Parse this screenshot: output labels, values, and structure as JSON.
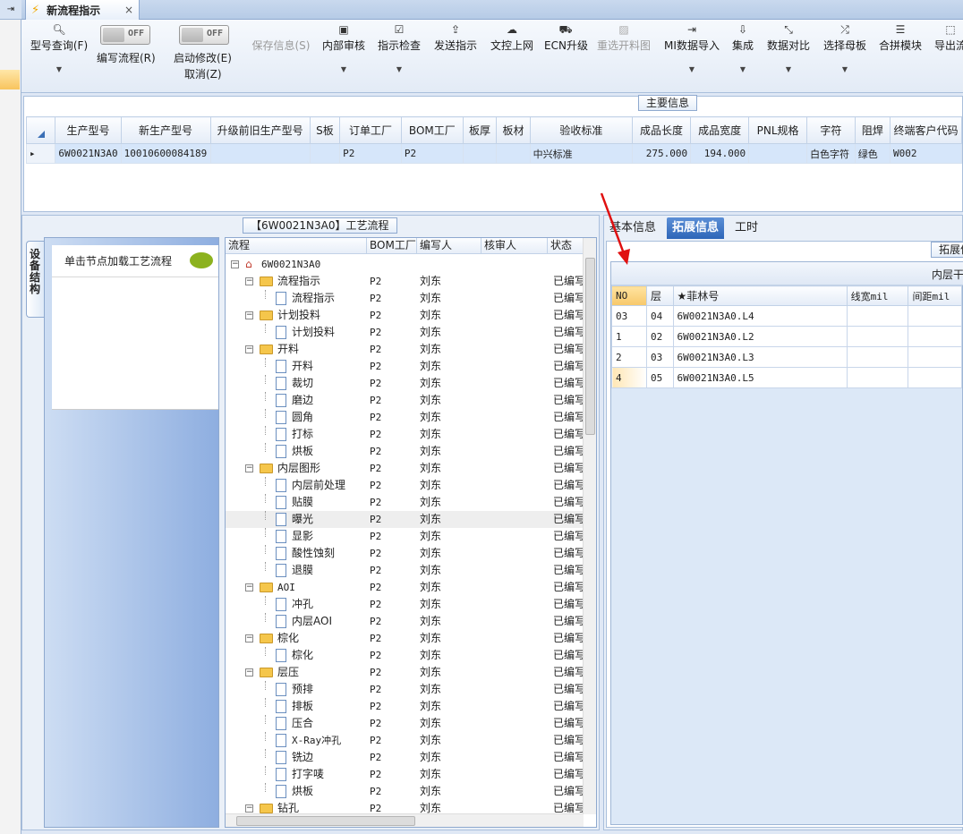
{
  "tab": {
    "title": "新流程指示",
    "close": "×"
  },
  "toolbar": {
    "model_query": "型号查询(F)",
    "write_flow": "编写流程(R)",
    "write_flow_toggle": "OFF",
    "start_modify": "启动修改(E)",
    "start_modify_toggle": "OFF",
    "cancel": "取消(Z)",
    "save_info": "保存信息(S)",
    "internal_review": "内部审核",
    "instruction_check": "指示检查",
    "send_instruction": "发送指示",
    "upload_doc": "文控上网",
    "ecn_upgrade": "ECN升级",
    "reselect_cut": "重选开料图",
    "mi_import": "MI数据导入",
    "integrate": "集成",
    "data_compare": "数据对比",
    "select_mother": "选择母板",
    "combine_module": "合拼模块",
    "export": "导出流"
  },
  "main_info": {
    "title": "主要信息",
    "columns": [
      "生产型号",
      "新生产型号",
      "升级前旧生产型号",
      "S板",
      "订单工厂",
      "BOM工厂",
      "板厚",
      "板材",
      "验收标准",
      "成品长度",
      "成品宽度",
      "PNL规格",
      "字符",
      "阻焊",
      "终端客户代码"
    ],
    "row": [
      "6W0021N3A0",
      "10010600084189",
      "",
      "",
      "P2",
      "P2",
      "",
      "",
      "中兴标准",
      "275.000",
      "194.000",
      "",
      "白色字符",
      "绿色",
      "W002"
    ]
  },
  "flow_panel": {
    "title": "【6W0021N3A0】工艺流程",
    "vertical_tab": "设备结构",
    "struct_hint": "单击节点加载工艺流程",
    "headers": [
      "流程",
      "BOM工厂",
      "编写人",
      "核审人",
      "状态"
    ],
    "rows": [
      {
        "name": "6W0021N3A0",
        "bom": "",
        "writer": "",
        "reviewer": "",
        "status": ""
      },
      {
        "name": "流程指示",
        "bom": "P2",
        "writer": "刘东",
        "reviewer": "",
        "status": "已编写"
      },
      {
        "name": "流程指示",
        "bom": "P2",
        "writer": "刘东",
        "reviewer": "",
        "status": "已编写"
      },
      {
        "name": "计划投料",
        "bom": "P2",
        "writer": "刘东",
        "reviewer": "",
        "status": "已编写"
      },
      {
        "name": "计划投料",
        "bom": "P2",
        "writer": "刘东",
        "reviewer": "",
        "status": "已编写"
      },
      {
        "name": "开料",
        "bom": "P2",
        "writer": "刘东",
        "reviewer": "",
        "status": "已编写"
      },
      {
        "name": "开料",
        "bom": "P2",
        "writer": "刘东",
        "reviewer": "",
        "status": "已编写"
      },
      {
        "name": "裁切",
        "bom": "P2",
        "writer": "刘东",
        "reviewer": "",
        "status": "已编写"
      },
      {
        "name": "磨边",
        "bom": "P2",
        "writer": "刘东",
        "reviewer": "",
        "status": "已编写"
      },
      {
        "name": "圆角",
        "bom": "P2",
        "writer": "刘东",
        "reviewer": "",
        "status": "已编写"
      },
      {
        "name": "打标",
        "bom": "P2",
        "writer": "刘东",
        "reviewer": "",
        "status": "已编写"
      },
      {
        "name": "烘板",
        "bom": "P2",
        "writer": "刘东",
        "reviewer": "",
        "status": "已编写"
      },
      {
        "name": "内层图形",
        "bom": "P2",
        "writer": "刘东",
        "reviewer": "",
        "status": "已编写"
      },
      {
        "name": "内层前处理",
        "bom": "P2",
        "writer": "刘东",
        "reviewer": "",
        "status": "已编写"
      },
      {
        "name": "贴膜",
        "bom": "P2",
        "writer": "刘东",
        "reviewer": "",
        "status": "已编写"
      },
      {
        "name": "曝光",
        "bom": "P2",
        "writer": "刘东",
        "reviewer": "",
        "status": "已编写"
      },
      {
        "name": "显影",
        "bom": "P2",
        "writer": "刘东",
        "reviewer": "",
        "status": "已编写"
      },
      {
        "name": "酸性蚀刻",
        "bom": "P2",
        "writer": "刘东",
        "reviewer": "",
        "status": "已编写"
      },
      {
        "name": "退膜",
        "bom": "P2",
        "writer": "刘东",
        "reviewer": "",
        "status": "已编写"
      },
      {
        "name": "AOI",
        "bom": "P2",
        "writer": "刘东",
        "reviewer": "",
        "status": "已编写"
      },
      {
        "name": "冲孔",
        "bom": "P2",
        "writer": "刘东",
        "reviewer": "",
        "status": "已编写"
      },
      {
        "name": "内层AOI",
        "bom": "P2",
        "writer": "刘东",
        "reviewer": "",
        "status": "已编写"
      },
      {
        "name": "棕化",
        "bom": "P2",
        "writer": "刘东",
        "reviewer": "",
        "status": "已编写"
      },
      {
        "name": "棕化",
        "bom": "P2",
        "writer": "刘东",
        "reviewer": "",
        "status": "已编写"
      },
      {
        "name": "层压",
        "bom": "P2",
        "writer": "刘东",
        "reviewer": "",
        "status": "已编写"
      },
      {
        "name": "预排",
        "bom": "P2",
        "writer": "刘东",
        "reviewer": "",
        "status": "已编写"
      },
      {
        "name": "排板",
        "bom": "P2",
        "writer": "刘东",
        "reviewer": "",
        "status": "已编写"
      },
      {
        "name": "压合",
        "bom": "P2",
        "writer": "刘东",
        "reviewer": "",
        "status": "已编写"
      },
      {
        "name": "X-Ray冲孔",
        "bom": "P2",
        "writer": "刘东",
        "reviewer": "",
        "status": "已编写"
      },
      {
        "name": "铣边",
        "bom": "P2",
        "writer": "刘东",
        "reviewer": "",
        "status": "已编写"
      },
      {
        "name": "打字唛",
        "bom": "P2",
        "writer": "刘东",
        "reviewer": "",
        "status": "已编写"
      },
      {
        "name": "烘板",
        "bom": "P2",
        "writer": "刘东",
        "reviewer": "",
        "status": "已编写"
      },
      {
        "name": "钻孔",
        "bom": "P2",
        "writer": "刘东",
        "reviewer": "",
        "status": "已编写"
      }
    ]
  },
  "right_panel": {
    "tabs": [
      "基本信息",
      "拓展信息",
      "工时"
    ],
    "section_title": "拓展信息",
    "band_label": "内层干",
    "headers": [
      "NO",
      "层",
      "★菲林号",
      "线宽mil",
      "间距mil"
    ],
    "rows": [
      {
        "no": "03",
        "layer": "04",
        "film": "6W0021N3A0.L4"
      },
      {
        "no": "1",
        "layer": "02",
        "film": "6W0021N3A0.L2"
      },
      {
        "no": "2",
        "layer": "03",
        "film": "6W0021N3A0.L3"
      },
      {
        "no": "4",
        "layer": "05",
        "film": "6W0021N3A0.L5"
      }
    ]
  }
}
